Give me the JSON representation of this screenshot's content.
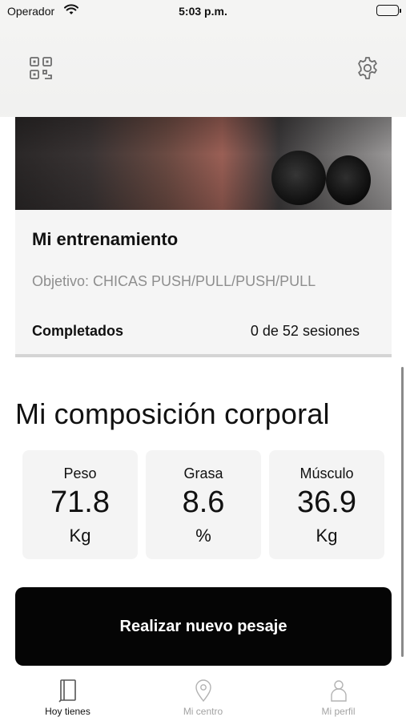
{
  "status_bar": {
    "carrier": "Operador",
    "time": "5:03 p.m."
  },
  "top_bar": {
    "left_icon": "qr-code-icon",
    "right_icon": "gear-icon"
  },
  "training": {
    "title": "Mi entrenamiento",
    "objective": "Objetivo: CHICAS PUSH/PULL/PUSH/PULL",
    "completed_label": "Completados",
    "completed_value": "0 de 52 sesiones"
  },
  "composition": {
    "title": "Mi composición corporal",
    "metrics": [
      {
        "label": "Peso",
        "value": "71.8",
        "unit": "Kg"
      },
      {
        "label": "Grasa",
        "value": "8.6",
        "unit": "%"
      },
      {
        "label": "Músculo",
        "value": "36.9",
        "unit": "Kg"
      }
    ],
    "button_label": "Realizar nuevo pesaje"
  },
  "tabs": [
    {
      "label": "Hoy tienes",
      "icon": "book-icon",
      "active": true
    },
    {
      "label": "Mi centro",
      "icon": "location-pin-icon",
      "active": false
    },
    {
      "label": "Mi perfil",
      "icon": "person-icon",
      "active": false
    }
  ],
  "colors": {
    "button_bg": "#050505",
    "card_bg": "#f5f5f5",
    "inactive_tab": "#a3a3a3",
    "muted_text": "#8e8e8e"
  }
}
